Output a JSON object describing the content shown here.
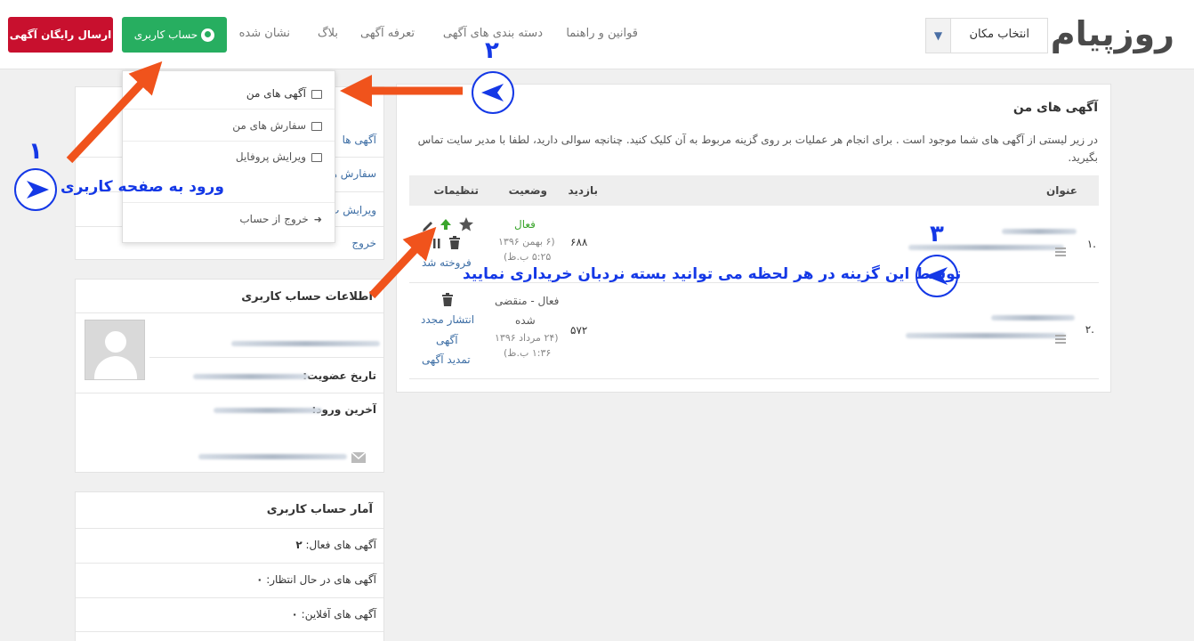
{
  "header": {
    "logo": "روزپیام",
    "location_select": "انتخاب مکان",
    "nav": [
      "قوانین و راهنما",
      "دسته بندی های آگهی",
      "تعرفه آگهی",
      "بلاگ",
      "نشان شده"
    ],
    "account_button": "حساب کاربری",
    "free_ad_button": "ارسال رایگان آگهی"
  },
  "dropdown": {
    "items": [
      "آگهی های من",
      "سفارش های من",
      "ویرایش پروفایل",
      "خروج از حساب"
    ]
  },
  "sidebar_menu": {
    "items_visible": [
      "آگهی ها",
      "سفارش ها",
      "ویرایش پ",
      "خروج"
    ]
  },
  "account_info": {
    "title": "اطلاعات حساب کاربری",
    "member_since_label": "تاریخ عضویت:",
    "last_login_label": "آخرین ورود:"
  },
  "stats": {
    "title": "آمار حساب کاربری",
    "active_label": "آگهی های فعال:",
    "active_value": "۲",
    "pending_label": "آگهی های در حال انتظار:",
    "pending_value": "۰",
    "offline_label": "آگهی های آفلاین:",
    "offline_value": "۰"
  },
  "main": {
    "title": "آگهی های من",
    "description": "در زیر لیستی از آگهی های شما موجود است . برای انجام هر عملیات بر روی گزینه مربوط به آن کلیک کنید. چنانچه سوالی دارید، لطفا با مدیر سایت تماس بگیرید.",
    "columns": [
      "عنوان",
      "بازدید",
      "وضعیت",
      "تنظیمات"
    ],
    "rows": [
      {
        "index": ".۱",
        "views": "۶۸۸",
        "status": "فعال",
        "date": "(۶ بهمن ۱۳۹۶",
        "time": "۵:۲۵ ب.ظ)",
        "action": "فروخته شد"
      },
      {
        "index": ".۲",
        "views": "۵۷۲",
        "status_line1": "فعال - منقضی",
        "status_line2": "شده",
        "date": "(۲۴ مرداد ۱۳۹۶",
        "time": "۱:۳۶ ب.ظ)",
        "action1": "انتشار مجدد",
        "action2": "آگهی",
        "action3": "تمدید آگهی"
      }
    ]
  },
  "annotations": {
    "step1_number": "۱",
    "step1_text": "ورود به صفحه کاربری",
    "step2_number": "۲",
    "step3_number": "۳",
    "step3_text": "توسط این گزینه در هر لحظه می توانید بسته نردبان خریداری نمایید"
  },
  "colors": {
    "brand_red": "#c8102e",
    "account_green": "#27ae60",
    "annotation_blue": "#1438e6",
    "arrow_orange": "#f0531c"
  }
}
